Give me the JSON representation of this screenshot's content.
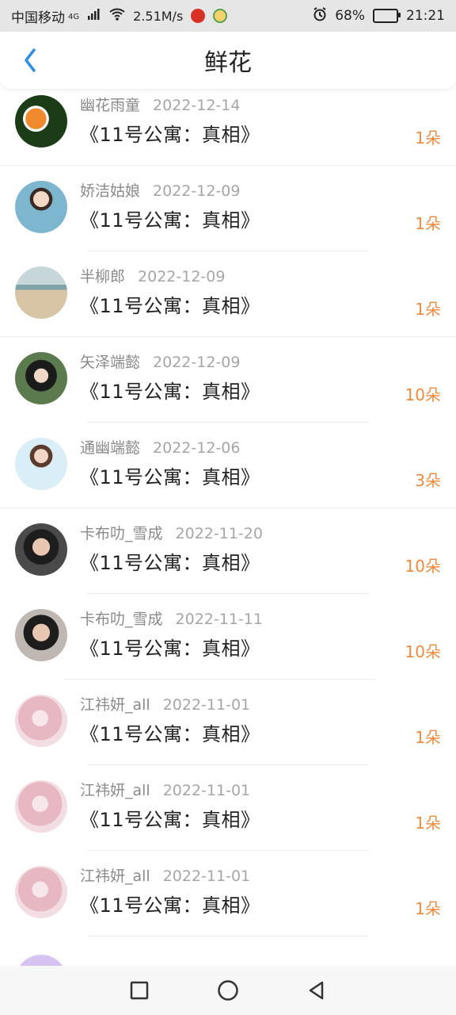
{
  "statusbar": {
    "carrier": "中国移动",
    "network_type": "4G",
    "speed": "2.51M/s",
    "battery": "68%",
    "time": "21:21",
    "icons": [
      "signal-icon",
      "wifi-icon",
      "alarm-icon",
      "battery-icon"
    ]
  },
  "header": {
    "title": "鲜花",
    "back_icon": "chevron-left-icon",
    "accent": "#2f8fe0"
  },
  "list": {
    "items": [
      {
        "name": "幽花雨童",
        "date": "2022-12-14",
        "book": "《11号公寓：真相》",
        "count": "1朵"
      },
      {
        "name": "娇洁姑娘",
        "date": "2022-12-09",
        "book": "《11号公寓：真相》",
        "count": "1朵"
      },
      {
        "name": "半柳郎",
        "date": "2022-12-09",
        "book": "《11号公寓：真相》",
        "count": "1朵"
      },
      {
        "name": "矢泽端懿",
        "date": "2022-12-09",
        "book": "《11号公寓：真相》",
        "count": "10朵"
      },
      {
        "name": "通幽端懿",
        "date": "2022-12-06",
        "book": "《11号公寓：真相》",
        "count": "3朵"
      },
      {
        "name": "卡布叻_雪成",
        "date": "2022-11-20",
        "book": "《11号公寓：真相》",
        "count": "10朵"
      },
      {
        "name": "卡布叻_雪成",
        "date": "2022-11-11",
        "book": "《11号公寓：真相》",
        "count": "10朵"
      },
      {
        "name": "江祎妍_all",
        "date": "2022-11-01",
        "book": "《11号公寓：真相》",
        "count": "1朵"
      },
      {
        "name": "江祎妍_all",
        "date": "2022-11-01",
        "book": "《11号公寓：真相》",
        "count": "1朵"
      },
      {
        "name": "江祎妍_all",
        "date": "2022-11-01",
        "book": "《11号公寓：真相》",
        "count": "1朵"
      }
    ],
    "count_color": "#f08a3c"
  },
  "navbar": {
    "icons": [
      "square-icon",
      "circle-icon",
      "triangle-back-icon"
    ]
  }
}
